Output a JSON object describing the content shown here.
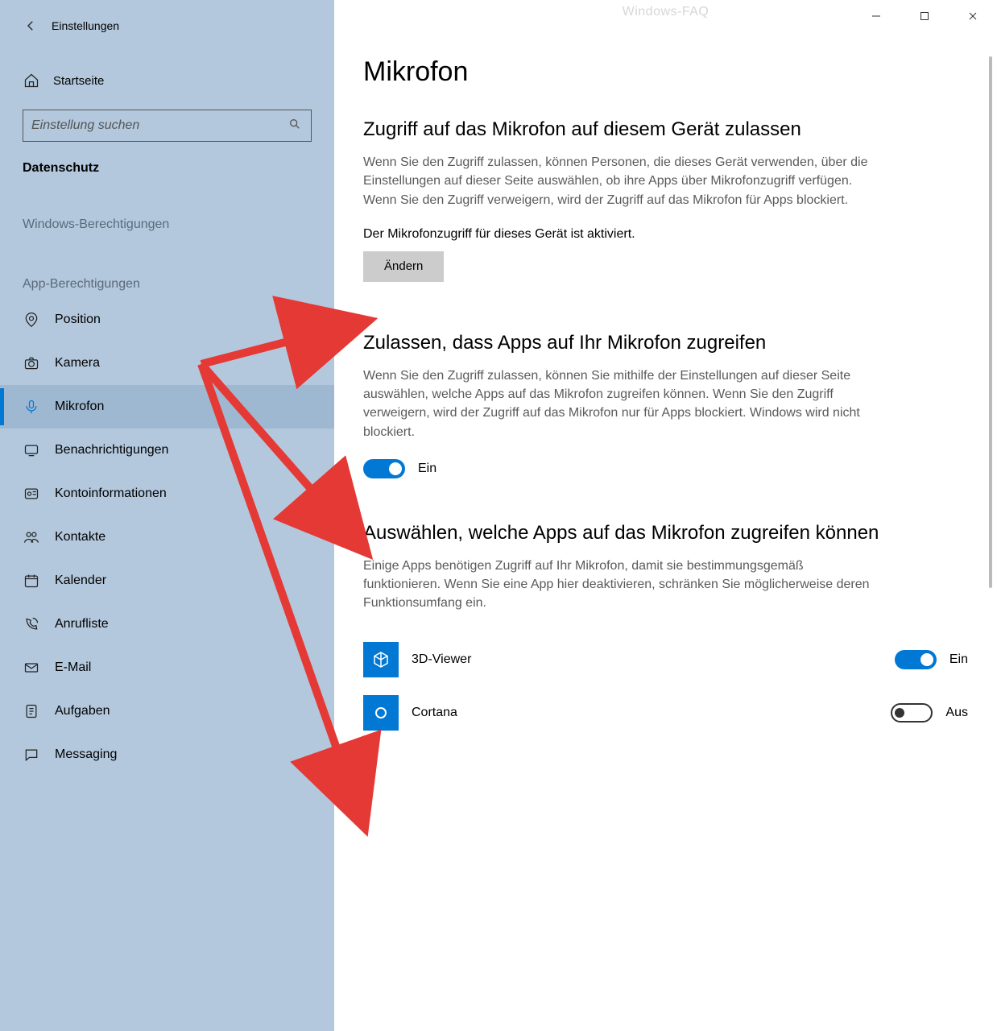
{
  "app_title": "Einstellungen",
  "watermark": "Windows-FAQ",
  "sidebar": {
    "home_label": "Startseite",
    "search_placeholder": "Einstellung suchen",
    "category_label": "Datenschutz",
    "section1_label": "Windows-Berechtigungen",
    "section2_label": "App-Berechtigungen",
    "items": [
      {
        "icon": "location",
        "label": "Position"
      },
      {
        "icon": "camera",
        "label": "Kamera"
      },
      {
        "icon": "microphone",
        "label": "Mikrofon",
        "selected": true
      },
      {
        "icon": "notifications",
        "label": "Benachrichtigungen"
      },
      {
        "icon": "account",
        "label": "Kontoinformationen"
      },
      {
        "icon": "contacts",
        "label": "Kontakte"
      },
      {
        "icon": "calendar",
        "label": "Kalender"
      },
      {
        "icon": "call-history",
        "label": "Anrufliste"
      },
      {
        "icon": "email",
        "label": "E-Mail"
      },
      {
        "icon": "tasks",
        "label": "Aufgaben"
      },
      {
        "icon": "messaging",
        "label": "Messaging"
      }
    ]
  },
  "page": {
    "title": "Mikrofon",
    "section1": {
      "title": "Zugriff auf das Mikrofon auf diesem Gerät zulassen",
      "desc": "Wenn Sie den Zugriff zulassen, können Personen, die dieses Gerät verwenden, über die Einstellungen auf dieser Seite auswählen, ob ihre Apps über Mikrofonzugriff verfügen. Wenn Sie den Zugriff verweigern, wird der Zugriff auf das Mikrofon für Apps blockiert.",
      "status": "Der Mikrofonzugriff für dieses Gerät ist aktiviert.",
      "button_label": "Ändern"
    },
    "section2": {
      "title": "Zulassen, dass Apps auf Ihr Mikrofon zugreifen",
      "desc": "Wenn Sie den Zugriff zulassen, können Sie mithilfe der Einstellungen auf dieser Seite auswählen, welche Apps auf das Mikrofon zugreifen können. Wenn Sie den Zugriff verweigern, wird der Zugriff auf das Mikrofon nur für Apps blockiert. Windows wird nicht blockiert.",
      "toggle_state": "on",
      "toggle_label": "Ein"
    },
    "section3": {
      "title": "Auswählen, welche Apps auf das Mikrofon zugreifen können",
      "desc": "Einige Apps benötigen Zugriff auf Ihr Mikrofon, damit sie bestimmungsgemäß funktionieren. Wenn Sie eine App hier deaktivieren, schränken Sie möglicherweise deren Funktionsumfang ein.",
      "apps": [
        {
          "name": "3D-Viewer",
          "icon": "cube",
          "state": "on",
          "state_label": "Ein"
        },
        {
          "name": "Cortana",
          "icon": "circle",
          "state": "off",
          "state_label": "Aus"
        }
      ]
    }
  }
}
